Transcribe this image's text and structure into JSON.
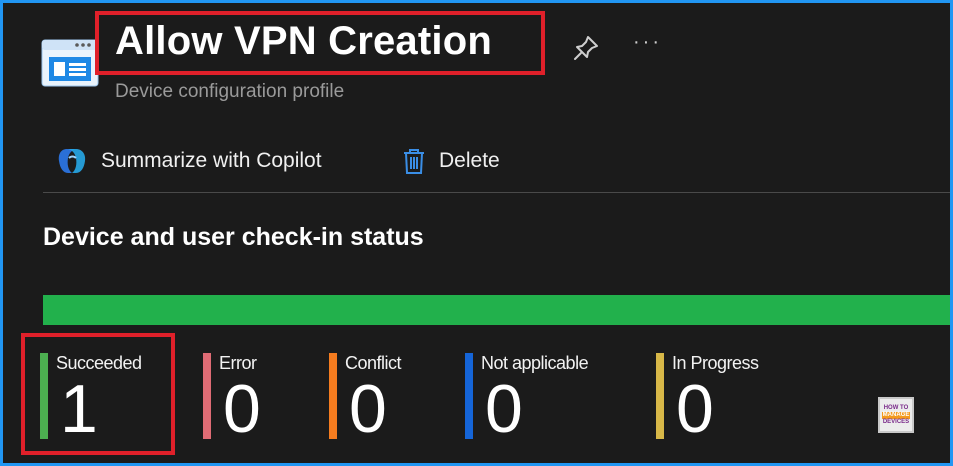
{
  "header": {
    "title": "Allow VPN Creation",
    "subtitle": "Device configuration profile",
    "more_label": "···"
  },
  "toolbar": {
    "copilot_label": "Summarize with Copilot",
    "delete_label": "Delete"
  },
  "checkin": {
    "title": "Device and user check-in status",
    "bar_fill_fraction": 1.0,
    "stats": [
      {
        "label": "Succeeded",
        "value": "1",
        "color": "#4caf50"
      },
      {
        "label": "Error",
        "value": "0",
        "color": "#e06c75"
      },
      {
        "label": "Conflict",
        "value": "0",
        "color": "#f57c1f"
      },
      {
        "label": "Not applicable",
        "value": "0",
        "color": "#1565d8"
      },
      {
        "label": "In Progress",
        "value": "0",
        "color": "#d8b848"
      }
    ]
  },
  "watermark": {
    "line1": "HOW TO",
    "line2": "MANAGE",
    "line3": "DEVICES"
  },
  "colors": {
    "accent_border": "#2196f3",
    "highlight": "#e0202a",
    "progress": "#22b14c",
    "background": "#1b1b1b"
  }
}
